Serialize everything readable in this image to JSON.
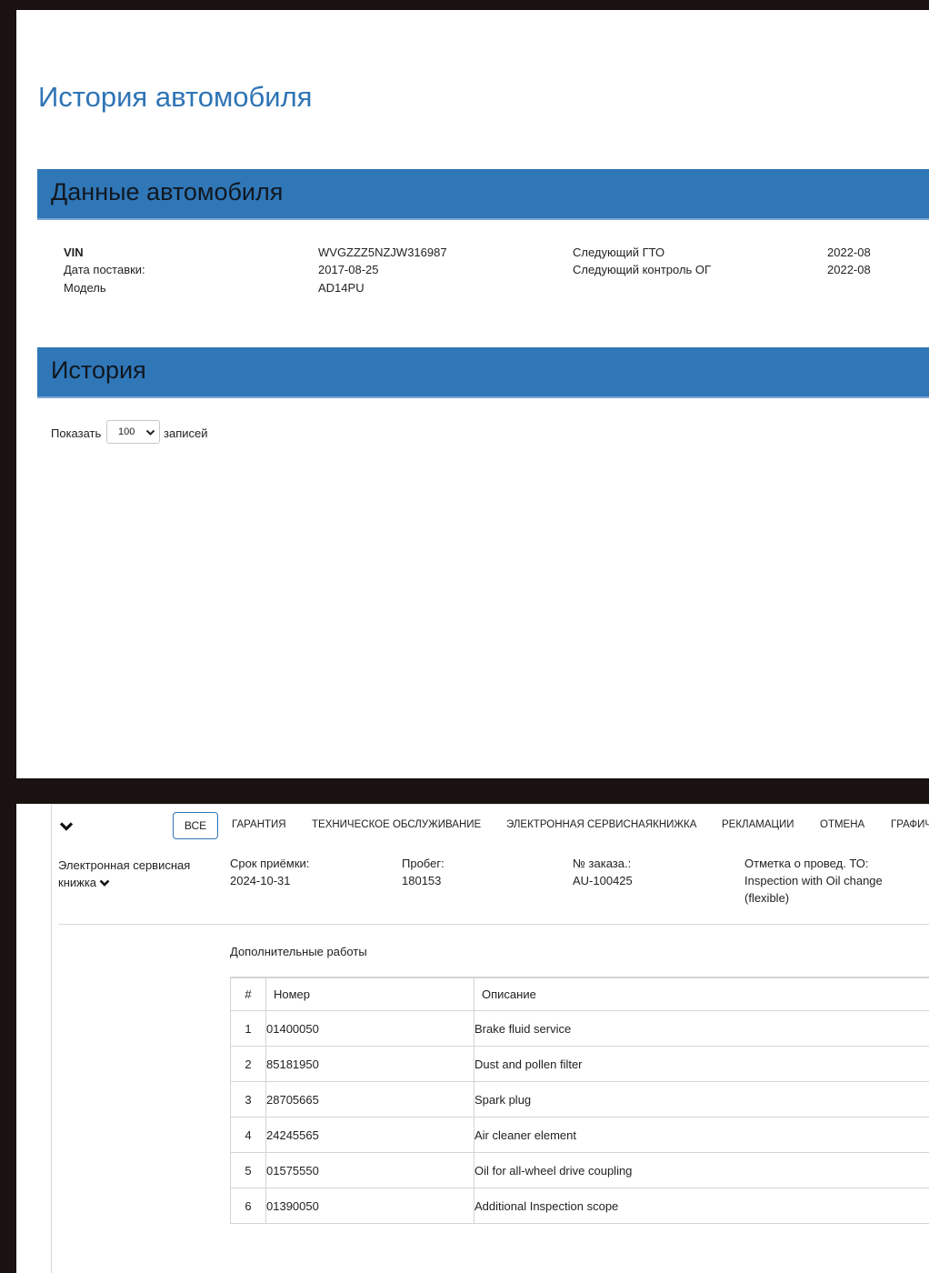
{
  "page": {
    "title": "История автомобиля"
  },
  "vehicle_section": {
    "title": "Данные автомобиля",
    "vin_label": "VIN",
    "vin_value": "WVGZZZ5NZJW316987",
    "delivery_label": "Дата поставки:",
    "delivery_value": "2017-08-25",
    "model_label": "Модель",
    "model_value": "AD14PU",
    "next_gto_label": "Следующий ГТО",
    "next_gto_value": "2022-08",
    "next_og_label": "Следующий контроль ОГ",
    "next_og_value": "2022-08"
  },
  "history_section": {
    "title": "История",
    "show_label": "Показать",
    "entries_value": "100",
    "entries_label": "записей"
  },
  "filter_tabs": {
    "all": "ВСЕ",
    "warranty": "ГАРАНТИЯ",
    "maintenance": "ТЕХНИЧЕСКОЕ ОБСЛУЖИВАНИЕ",
    "e_book": "ЭЛЕКТРОННАЯ СЕРВИСНАЯКНИЖКА",
    "claims": "РЕКЛАМАЦИИ",
    "cancel": "ОТМЕНА",
    "graph": "ГРАФИЧ"
  },
  "record": {
    "type_line1": "Электронная сервисная",
    "type_line2": "книжка",
    "intake_label": "Срок приёмки:",
    "intake_value": "2024-10-31",
    "mileage_label": "Пробег:",
    "mileage_value": "180153",
    "order_label": "№ заказа.:",
    "order_value": "AU-100425",
    "mark_label": "Отметка о провед. ТО:",
    "mark_value_line1": "Inspection with Oil change",
    "mark_value_line2": "(flexible)"
  },
  "additional_works": {
    "title": "Дополнительные работы",
    "columns": {
      "num": "#",
      "code": "Номер",
      "desc": "Описание"
    },
    "rows": [
      {
        "num": "1",
        "code": "01400050",
        "desc": "Brake fluid service"
      },
      {
        "num": "2",
        "code": "85181950",
        "desc": "Dust and pollen filter"
      },
      {
        "num": "3",
        "code": "28705665",
        "desc": "Spark plug"
      },
      {
        "num": "4",
        "code": "24245565",
        "desc": "Air cleaner element"
      },
      {
        "num": "5",
        "code": "01575550",
        "desc": "Oil for all-wheel drive coupling"
      },
      {
        "num": "6",
        "code": "01390050",
        "desc": "Additional Inspection scope"
      }
    ]
  }
}
